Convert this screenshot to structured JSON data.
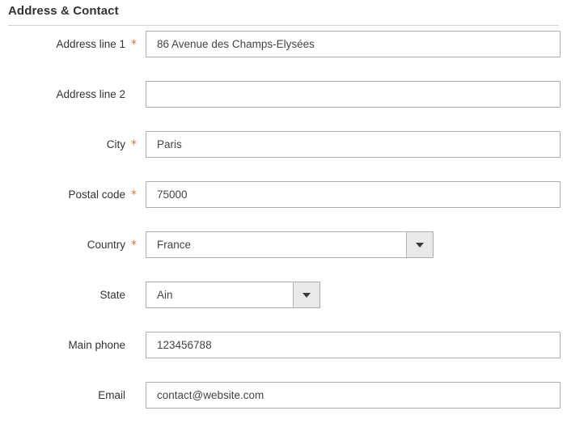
{
  "section": {
    "title": "Address & Contact"
  },
  "fields": [
    {
      "label": "Address line 1",
      "required": true,
      "required_marker": "*",
      "control": "text",
      "value": "86 Avenue des Champs-Elysées",
      "placeholder": "",
      "name": "address-line-1"
    },
    {
      "label": "Address line 2",
      "required": false,
      "required_marker": "",
      "control": "text",
      "value": "",
      "placeholder": "",
      "name": "address-line-2"
    },
    {
      "label": "City",
      "required": true,
      "required_marker": "*",
      "control": "text",
      "value": "Paris",
      "placeholder": "",
      "name": "city"
    },
    {
      "label": "Postal code",
      "required": true,
      "required_marker": "*",
      "control": "text",
      "value": "75000",
      "placeholder": "",
      "name": "postal-code"
    },
    {
      "label": "Country",
      "required": true,
      "required_marker": "*",
      "control": "select",
      "value": "France",
      "placeholder": "",
      "name": "country"
    },
    {
      "label": "State",
      "required": false,
      "required_marker": "",
      "control": "select",
      "value": "Ain",
      "placeholder": "",
      "name": "state"
    },
    {
      "label": "Main phone",
      "required": false,
      "required_marker": "",
      "control": "text",
      "value": "123456788",
      "placeholder": "",
      "name": "main-phone"
    },
    {
      "label": "Email",
      "required": false,
      "required_marker": "",
      "control": "text",
      "value": "contact@website.com",
      "placeholder": "",
      "name": "email"
    }
  ],
  "colors": {
    "required_star": "#d4713f",
    "label_text": "#333333",
    "input_border": "#adadad",
    "divider": "#d8d3cb",
    "select_button_bg": "#e9e9e9",
    "background": "#ffffff"
  }
}
